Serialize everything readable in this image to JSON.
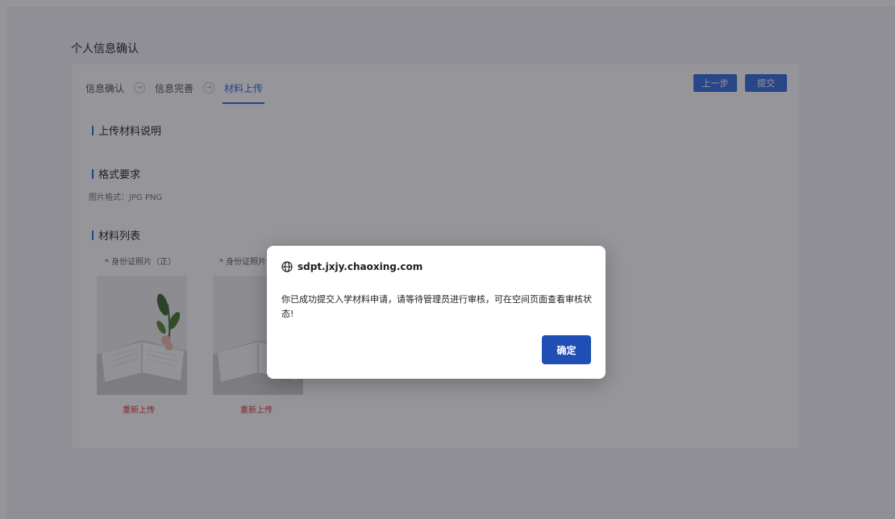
{
  "page": {
    "title": "个人信息确认"
  },
  "steps": [
    {
      "label": "信息确认",
      "sep": "→"
    },
    {
      "label": "信息完善",
      "sep": "→"
    },
    {
      "label": "材料上传"
    }
  ],
  "toolbar": {
    "prev_label": "上一步",
    "submit_label": "提交"
  },
  "sections": {
    "upload_desc": "上传材料说明",
    "format_req": "格式要求",
    "format_text": "图片格式：JPG PNG",
    "material_list": "材料列表"
  },
  "materials": [
    {
      "label": "* 身份证照片（正）",
      "action": "重新上传"
    },
    {
      "label": "* 身份证照片（反）",
      "action": "重新上传"
    }
  ],
  "dialog": {
    "host": "sdpt.jxjy.chaoxing.com",
    "message": "你已成功提交入学材料申请，请等待管理员进行审核，可在空间页面查看审核状态!",
    "ok_label": "确定"
  },
  "colors": {
    "accent": "#2f6fde",
    "primary_button": "#1f4eb4",
    "danger": "#e03535"
  }
}
